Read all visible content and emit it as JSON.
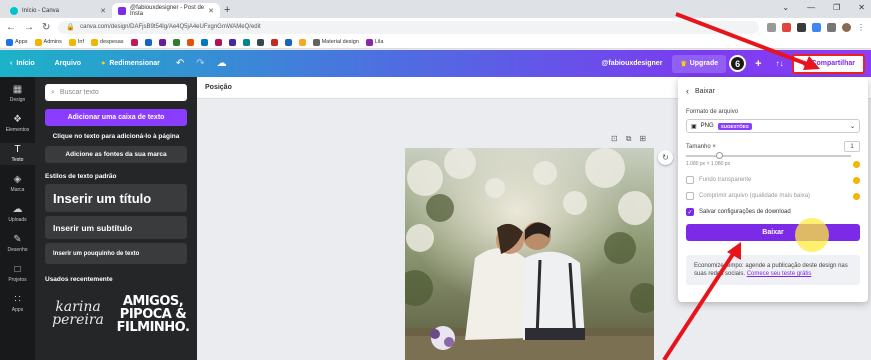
{
  "browser": {
    "tabs": [
      {
        "title": "Início - Canva",
        "active": false
      },
      {
        "title": "@fabiouxdesigner - Post de Insta",
        "active": true
      }
    ],
    "url": "canva.com/design/DAFjsB9t54Ig/Ae4Q5jA4eUFxgnGmWAMeQ/edit",
    "bookmarks": [
      "Apps",
      "Admins",
      "Inf",
      "despesas",
      "",
      "",
      "",
      "",
      "",
      "",
      "",
      "",
      "",
      "",
      "",
      "",
      "",
      "Material design",
      "Lila"
    ]
  },
  "toolbar": {
    "home": "Início",
    "file": "Arquivo",
    "resize": "Redimensionar",
    "username": "@fabiouxdesigner",
    "upgrade": "Upgrade",
    "avatar_letter": "6",
    "stats": "↑↓",
    "share": "Compartilhar"
  },
  "rail": [
    {
      "label": "Design",
      "icon": "▦"
    },
    {
      "label": "Elementos",
      "icon": "❖"
    },
    {
      "label": "Texto",
      "icon": "T",
      "active": true
    },
    {
      "label": "Marca",
      "icon": "◈"
    },
    {
      "label": "Uploads",
      "icon": "☁"
    },
    {
      "label": "Desenho",
      "icon": "✎"
    },
    {
      "label": "Projetos",
      "icon": "□"
    },
    {
      "label": "Apps",
      "icon": "∷"
    }
  ],
  "panel": {
    "search_placeholder": "Buscar texto",
    "add_textbox": "Adicionar uma caixa de texto",
    "hint": "Clique no texto para adicioná-lo à página",
    "add_brand_fonts": "Adicione as fontes da sua marca",
    "default_styles_title": "Estilos de texto padrão",
    "styles": [
      "Inserir um título",
      "Inserir um subtítulo",
      "Inserir um pouquinho de texto"
    ],
    "recent_title": "Usados recentemente",
    "recent_fonts": [
      "karina pereira",
      "AMIGOS, PIPOCA & FILMINHO."
    ]
  },
  "editor": {
    "position_label": "Posição"
  },
  "download": {
    "title": "Baixar",
    "format_label": "Formato de arquivo",
    "format_value": "PNG",
    "format_badge": "SUGESTÕES",
    "size_label": "Tamanho ×",
    "size_value": "1",
    "dims": "1.080 px × 1.080 px",
    "options": [
      {
        "label": "Fundo transparente",
        "checked": false,
        "premium": true
      },
      {
        "label": "Comprimir arquivo (qualidade mais baixa)",
        "checked": false,
        "premium": true
      },
      {
        "label": "Salvar configurações de download",
        "checked": true,
        "premium": false
      }
    ],
    "button": "Baixar",
    "promo_text": "Economize tempo: agende a publicação deste design nas suas redes sociais.",
    "promo_link": "Comece seu teste grátis"
  }
}
